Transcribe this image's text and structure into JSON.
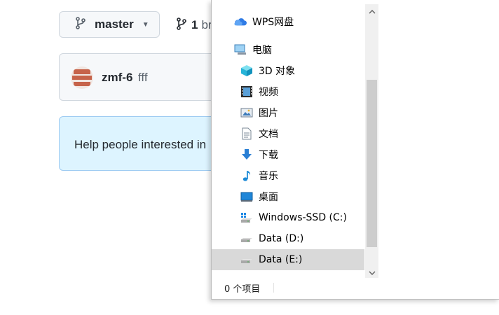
{
  "repo": {
    "branch_selector": {
      "label": "master"
    },
    "branch_count": {
      "number": "1",
      "word_visible": "br"
    },
    "latest_commit": {
      "author": "zmf-6",
      "message": "fff"
    },
    "readme_prompt": {
      "text": "Help people interested in"
    }
  },
  "explorer": {
    "tree_items": [
      {
        "label": "WPS网盘",
        "icon": "cloud-icon",
        "level": 0
      },
      {
        "label": "电脑",
        "icon": "computer-icon",
        "level": 0
      },
      {
        "label": "3D 对象",
        "icon": "3d-objects-icon",
        "level": 1
      },
      {
        "label": "视频",
        "icon": "video-icon",
        "level": 1
      },
      {
        "label": "图片",
        "icon": "pictures-icon",
        "level": 1
      },
      {
        "label": "文档",
        "icon": "document-icon",
        "level": 1
      },
      {
        "label": "下载",
        "icon": "download-icon",
        "level": 1
      },
      {
        "label": "音乐",
        "icon": "music-icon",
        "level": 1
      },
      {
        "label": "桌面",
        "icon": "desktop-icon",
        "level": 1
      },
      {
        "label": "Windows-SSD (C:)",
        "icon": "system-drive-icon",
        "level": 1
      },
      {
        "label": "Data (D:)",
        "icon": "drive-icon",
        "level": 1
      },
      {
        "label": "Data (E:)",
        "icon": "drive-icon",
        "level": 1,
        "selected": true
      }
    ],
    "status": {
      "item_count": "0 个项目"
    }
  },
  "colors": {
    "github_border": "#d0d7de",
    "readme_banner_bg": "#ddf4ff",
    "selection_bg": "#d9d9d9",
    "scroll_thumb": "#cdcdcd"
  }
}
